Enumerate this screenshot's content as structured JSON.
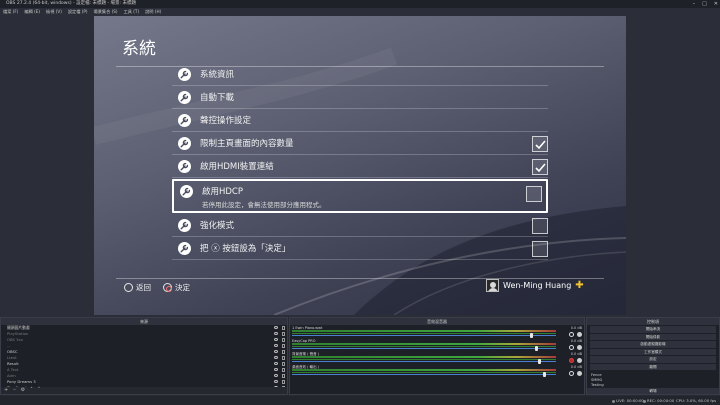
{
  "window": {
    "title": "OBS 27.2.4 (64-bit, windows) - 設定檔: 未標題 - 場景: 未標題",
    "controls": [
      "–",
      "□",
      "✕"
    ]
  },
  "menubar": [
    "檔案 (F)",
    "編輯 (E)",
    "檢視 (V)",
    "設定檔 (P)",
    "場景集合 (S)",
    "工具 (T)",
    "說明 (H)"
  ],
  "ps4": {
    "heading": "系統",
    "items": [
      {
        "label": "系統資訊",
        "checkbox": false
      },
      {
        "label": "自動下載",
        "checkbox": false
      },
      {
        "label": "聲控操作設定",
        "checkbox": false
      },
      {
        "label": "限制主頁畫面的內容數量",
        "checkbox": true,
        "checked": true
      },
      {
        "label": "啟用HDMI裝置連結",
        "checkbox": true,
        "checked": true
      },
      {
        "label": "啟用HDCP",
        "sub": "若停用此設定，會無法使用部分應用程式。",
        "checkbox": true,
        "checked": false,
        "selected": true
      },
      {
        "label": "強化模式",
        "checkbox": true,
        "checked": false
      },
      {
        "label": "把 ⓧ 按鈕設為「決定」",
        "checkbox": true,
        "checked": false
      }
    ],
    "footer": {
      "back": "返回",
      "confirm": "決定"
    },
    "user": {
      "name": "Wen-Ming Huang",
      "plus_icon": "plus-icon",
      "plus_color": "#f2c230"
    }
  },
  "docks": {
    "scenes": {
      "title": "來源",
      "rows": [
        {
          "text": "開頭圖片動畫",
          "dim": false
        },
        {
          "text": "PlayStation",
          "dim": true
        },
        {
          "text": "OBS 3xx",
          "dim": true
        },
        {
          "text": "...",
          "dim": true
        },
        {
          "text": "OBSC",
          "dim": false
        },
        {
          "text": "Ltext",
          "dim": true
        },
        {
          "text": "Result",
          "dim": false
        },
        {
          "text": "A Text",
          "dim": true
        },
        {
          "text": "Adm",
          "dim": true
        },
        {
          "text": "Pony Dreams 3",
          "dim": false
        },
        {
          "text": "The Gaunt",
          "dim": false
        },
        {
          "text": "Mumsbot",
          "dim": true
        }
      ],
      "tools": [
        "+",
        "–",
        "⚙",
        "˄",
        "˅"
      ]
    },
    "mixer": {
      "title": "音效混音器",
      "tracks": [
        {
          "name": "1 Ewin Piano.wwt",
          "db": "0.0 dB",
          "muted": false,
          "level": 0.9
        },
        {
          "name": "EasyCap PRO",
          "db": "0.0 dB",
          "muted": false,
          "level": 0.92
        },
        {
          "name": "背景音樂 ( 聲音 )",
          "db": "0.0 dB",
          "muted": true,
          "level": 0.93
        },
        {
          "name": "桌面音效 ( 輸出 )",
          "db": "0.0 dB",
          "muted": false,
          "level": 0.95
        }
      ]
    },
    "controls": {
      "title": "控制項",
      "buttons": [
        "開始串流",
        "開始錄影",
        "啟動虛擬攝影機",
        "工作室模式",
        "設定",
        "離開"
      ],
      "transitions": [
        "Fence",
        "SMMG",
        "Testing"
      ],
      "tail": "轉場"
    }
  },
  "status": {
    "live": "LIVE: 00:00:00",
    "rec": "REC: 00:00:00",
    "cpu": "CPU: 3.0%, 60.00 fps"
  }
}
